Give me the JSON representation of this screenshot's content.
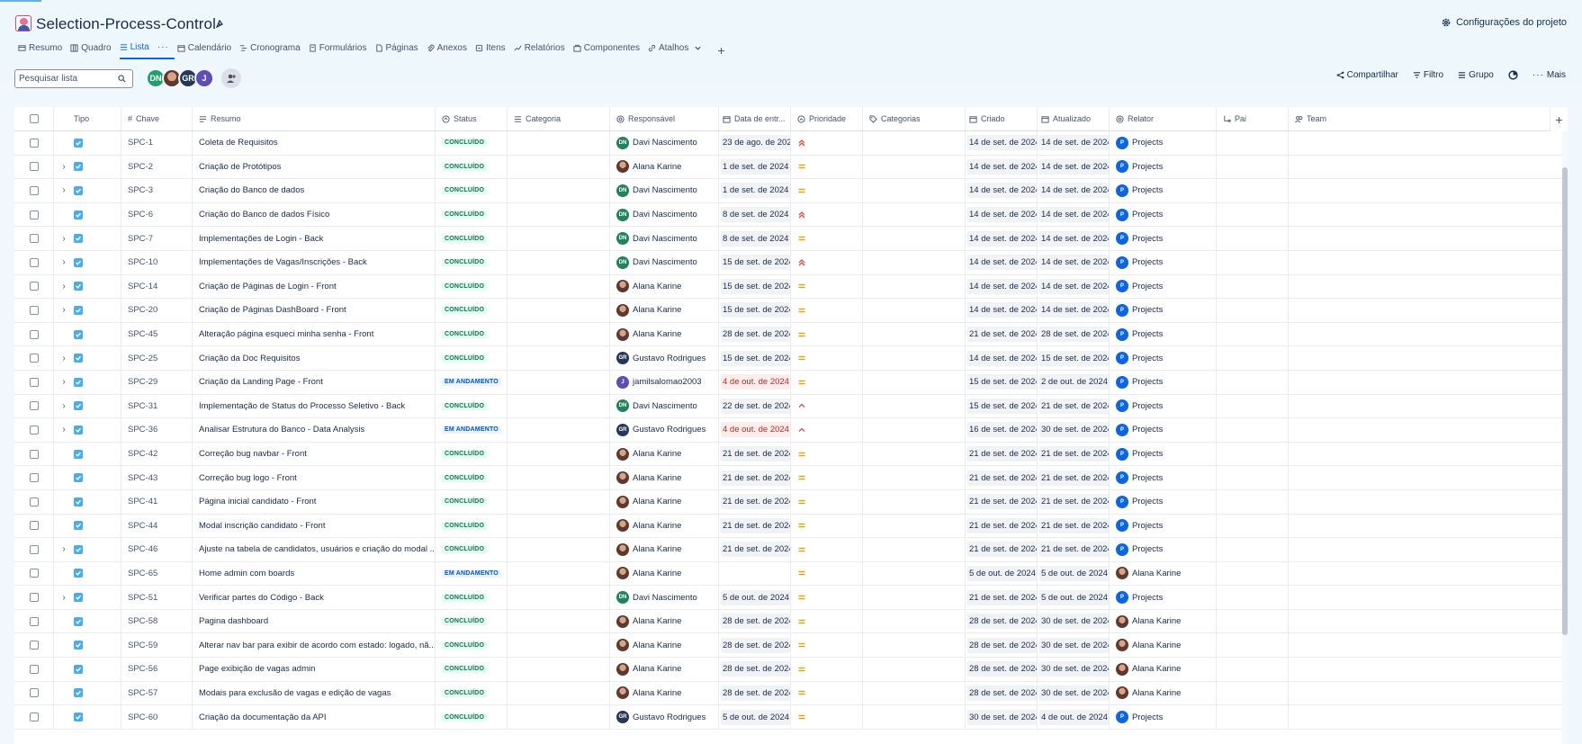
{
  "project": {
    "title": "Selection-Process-Control",
    "settings_label": "Configurações do projeto"
  },
  "tabs": [
    {
      "label": "Resumo",
      "icon": "summary-icon"
    },
    {
      "label": "Quadro",
      "icon": "board-icon"
    },
    {
      "label": "Lista",
      "icon": "list-icon",
      "active": true
    },
    {
      "label": "Calendário",
      "icon": "calendar-icon"
    },
    {
      "label": "Cronograma",
      "icon": "timeline-icon"
    },
    {
      "label": "Formulários",
      "icon": "form-icon"
    },
    {
      "label": "Páginas",
      "icon": "page-icon"
    },
    {
      "label": "Anexos",
      "icon": "attachment-icon"
    },
    {
      "label": "Itens",
      "icon": "issues-icon"
    },
    {
      "label": "Relatórios",
      "icon": "reports-icon"
    },
    {
      "label": "Componentes",
      "icon": "component-icon"
    },
    {
      "label": "Atalhos",
      "icon": "shortcut-icon"
    }
  ],
  "toolbar": {
    "search_placeholder": "Pesquisar lista",
    "avatars": [
      "DN",
      "",
      "GR",
      "J"
    ],
    "share_label": "Compartilhar",
    "filter_label": "Filtro",
    "group_label": "Grupo",
    "more_label": "Mais"
  },
  "columns": {
    "tipo": "Tipo",
    "chave": "Chave",
    "resumo": "Resumo",
    "status": "Status",
    "categoria": "Categoria",
    "responsavel": "Responsável",
    "data_entrega": "Data de entr...",
    "prioridade": "Prioridade",
    "categorias": "Categorias",
    "criado": "Criado",
    "atualizado": "Atualizado",
    "relator": "Relator",
    "pai": "Pai",
    "team": "Team"
  },
  "colors": {
    "done_bg": "#dcfff1",
    "done_fg": "#216e4e",
    "progress_bg": "#e9f2ff",
    "progress_fg": "#0055cc",
    "overdue": "#ae2e24",
    "accent": "#0c66e4"
  },
  "rows": [
    {
      "expand": false,
      "key": "SPC-1",
      "summary": "Coleta de Requisitos",
      "status": "CONCLUÍDO",
      "assignee": "Davi Nascimento",
      "assignee_initials": "DN",
      "due": "23 de ago. de 202",
      "due_overdue": false,
      "priority": "highest",
      "created": "14 de set. de 2024",
      "updated": "14 de set. de 2024",
      "reporter": "Projects",
      "reporter_initials": "P"
    },
    {
      "expand": true,
      "key": "SPC-2",
      "summary": "Criação de Protótipos",
      "status": "CONCLUÍDO",
      "assignee": "Alana Karine",
      "assignee_initials": "",
      "due": "1 de set. de 2024",
      "due_overdue": false,
      "priority": "medium",
      "created": "14 de set. de 2024",
      "updated": "14 de set. de 2024",
      "reporter": "Projects",
      "reporter_initials": "P"
    },
    {
      "expand": true,
      "key": "SPC-3",
      "summary": "Criação do Banco de dados",
      "status": "CONCLUÍDO",
      "assignee": "Davi Nascimento",
      "assignee_initials": "DN",
      "due": "1 de set. de 2024",
      "due_overdue": false,
      "priority": "medium",
      "created": "14 de set. de 2024",
      "updated": "14 de set. de 2024",
      "reporter": "Projects",
      "reporter_initials": "P"
    },
    {
      "expand": false,
      "key": "SPC-6",
      "summary": "Criação do Banco de dados Físico",
      "status": "CONCLUÍDO",
      "assignee": "Davi Nascimento",
      "assignee_initials": "DN",
      "due": "8 de set. de 2024",
      "due_overdue": false,
      "priority": "highest",
      "created": "14 de set. de 2024",
      "updated": "14 de set. de 2024",
      "reporter": "Projects",
      "reporter_initials": "P"
    },
    {
      "expand": true,
      "key": "SPC-7",
      "summary": "Implementações de Login - Back",
      "status": "CONCLUÍDO",
      "assignee": "Davi Nascimento",
      "assignee_initials": "DN",
      "due": "8 de set. de 2024",
      "due_overdue": false,
      "priority": "medium",
      "created": "14 de set. de 2024",
      "updated": "14 de set. de 2024",
      "reporter": "Projects",
      "reporter_initials": "P"
    },
    {
      "expand": true,
      "key": "SPC-10",
      "summary": "Implementações de Vagas/Inscrições - Back",
      "status": "CONCLUÍDO",
      "assignee": "Davi Nascimento",
      "assignee_initials": "DN",
      "due": "15 de set. de 2024",
      "due_overdue": false,
      "priority": "highest",
      "created": "14 de set. de 2024",
      "updated": "14 de set. de 2024",
      "reporter": "Projects",
      "reporter_initials": "P"
    },
    {
      "expand": true,
      "key": "SPC-14",
      "summary": "Criação de Páginas de Login - Front",
      "status": "CONCLUÍDO",
      "assignee": "Alana Karine",
      "assignee_initials": "",
      "due": "15 de set. de 2024",
      "due_overdue": false,
      "priority": "medium",
      "created": "14 de set. de 2024",
      "updated": "14 de set. de 2024",
      "reporter": "Projects",
      "reporter_initials": "P"
    },
    {
      "expand": true,
      "key": "SPC-20",
      "summary": "Criação de Páginas DashBoard - Front",
      "status": "CONCLUÍDO",
      "assignee": "Alana Karine",
      "assignee_initials": "",
      "due": "15 de set. de 2024",
      "due_overdue": false,
      "priority": "medium",
      "created": "14 de set. de 2024",
      "updated": "14 de set. de 2024",
      "reporter": "Projects",
      "reporter_initials": "P"
    },
    {
      "expand": false,
      "key": "SPC-45",
      "summary": "Alteração página esqueci minha senha - Front",
      "status": "CONCLUÍDO",
      "assignee": "Alana Karine",
      "assignee_initials": "",
      "due": "28 de set. de 2024",
      "due_overdue": false,
      "priority": "medium",
      "created": "21 de set. de 2024",
      "updated": "28 de set. de 2024",
      "reporter": "Projects",
      "reporter_initials": "P"
    },
    {
      "expand": true,
      "key": "SPC-25",
      "summary": "Criação da Doc Requisitos",
      "status": "CONCLUÍDO",
      "assignee": "Gustavo Rodrigues",
      "assignee_initials": "GR",
      "due": "15 de set. de 2024",
      "due_overdue": false,
      "priority": "medium",
      "created": "14 de set. de 2024",
      "updated": "15 de set. de 2024",
      "reporter": "Projects",
      "reporter_initials": "P"
    },
    {
      "expand": true,
      "key": "SPC-29",
      "summary": "Criação da Landing Page - Front",
      "status": "EM ANDAMENTO",
      "assignee": "jamilsalomao2003",
      "assignee_initials": "J",
      "due": "4 de out. de 2024",
      "due_overdue": true,
      "priority": "medium",
      "created": "15 de set. de 2024",
      "updated": "2 de out. de 2024",
      "reporter": "Projects",
      "reporter_initials": "P"
    },
    {
      "expand": true,
      "key": "SPC-31",
      "summary": "Implementação de Status do Processo Seletivo - Back",
      "status": "CONCLUÍDO",
      "assignee": "Davi Nascimento",
      "assignee_initials": "DN",
      "due": "22 de set. de 2024",
      "due_overdue": false,
      "priority": "high",
      "created": "15 de set. de 2024",
      "updated": "21 de set. de 2024",
      "reporter": "Projects",
      "reporter_initials": "P"
    },
    {
      "expand": true,
      "key": "SPC-36",
      "summary": "Analisar Estrutura do Banco - Data Analysis",
      "status": "EM ANDAMENTO",
      "assignee": "Gustavo Rodrigues",
      "assignee_initials": "GR",
      "due": "4 de out. de 2024",
      "due_overdue": true,
      "priority": "high",
      "created": "16 de set. de 2024",
      "updated": "30 de set. de 2024",
      "reporter": "Projects",
      "reporter_initials": "P"
    },
    {
      "expand": false,
      "key": "SPC-42",
      "summary": "Correção bug navbar - Front",
      "status": "CONCLUÍDO",
      "assignee": "Alana Karine",
      "assignee_initials": "",
      "due": "21 de set. de 2024",
      "due_overdue": false,
      "priority": "medium",
      "created": "21 de set. de 2024",
      "updated": "21 de set. de 2024",
      "reporter": "Projects",
      "reporter_initials": "P"
    },
    {
      "expand": false,
      "key": "SPC-43",
      "summary": "Correção bug logo - Front",
      "status": "CONCLUÍDO",
      "assignee": "Alana Karine",
      "assignee_initials": "",
      "due": "21 de set. de 2024",
      "due_overdue": false,
      "priority": "medium",
      "created": "21 de set. de 2024",
      "updated": "21 de set. de 2024",
      "reporter": "Projects",
      "reporter_initials": "P"
    },
    {
      "expand": false,
      "key": "SPC-41",
      "summary": "Página inicial candidato - Front",
      "status": "CONCLUÍDO",
      "assignee": "Alana Karine",
      "assignee_initials": "",
      "due": "21 de set. de 2024",
      "due_overdue": false,
      "priority": "medium",
      "created": "21 de set. de 2024",
      "updated": "21 de set. de 2024",
      "reporter": "Projects",
      "reporter_initials": "P"
    },
    {
      "expand": false,
      "key": "SPC-44",
      "summary": "Modal inscrição candidato - Front",
      "status": "CONCLUÍDO",
      "assignee": "Alana Karine",
      "assignee_initials": "",
      "due": "21 de set. de 2024",
      "due_overdue": false,
      "priority": "medium",
      "created": "21 de set. de 2024",
      "updated": "21 de set. de 2024",
      "reporter": "Projects",
      "reporter_initials": "P"
    },
    {
      "expand": true,
      "key": "SPC-46",
      "summary": "Ajuste na tabela de candidatos, usuários e criação do modal ...",
      "status": "CONCLUÍDO",
      "assignee": "Alana Karine",
      "assignee_initials": "",
      "due": "21 de set. de 2024",
      "due_overdue": false,
      "priority": "medium",
      "created": "21 de set. de 2024",
      "updated": "21 de set. de 2024",
      "reporter": "Projects",
      "reporter_initials": "P"
    },
    {
      "expand": false,
      "key": "SPC-65",
      "summary": "Home admin com boards",
      "status": "EM ANDAMENTO",
      "assignee": "Alana Karine",
      "assignee_initials": "",
      "due": "",
      "due_overdue": false,
      "priority": "medium",
      "created": "5 de out. de 2024",
      "updated": "5 de out. de 2024",
      "reporter": "Alana Karine",
      "reporter_initials": ""
    },
    {
      "expand": true,
      "key": "SPC-51",
      "summary": "Verificar partes do Código - Back",
      "status": "CONCLUÍDO",
      "assignee": "Davi Nascimento",
      "assignee_initials": "DN",
      "due": "5 de out. de 2024",
      "due_overdue": false,
      "priority": "medium",
      "created": "21 de set. de 2024",
      "updated": "5 de out. de 2024",
      "reporter": "Projects",
      "reporter_initials": "P"
    },
    {
      "expand": false,
      "key": "SPC-58",
      "summary": "Pagina dashboard",
      "status": "CONCLUÍDO",
      "assignee": "Alana Karine",
      "assignee_initials": "",
      "due": "28 de set. de 2024",
      "due_overdue": false,
      "priority": "medium",
      "created": "28 de set. de 2024",
      "updated": "30 de set. de 2024",
      "reporter": "Alana Karine",
      "reporter_initials": ""
    },
    {
      "expand": false,
      "key": "SPC-59",
      "summary": "Alterar nav bar para exibir de acordo com estado: logado, nã...",
      "status": "CONCLUÍDO",
      "assignee": "Alana Karine",
      "assignee_initials": "",
      "due": "28 de set. de 2024",
      "due_overdue": false,
      "priority": "medium",
      "created": "28 de set. de 2024",
      "updated": "30 de set. de 2024",
      "reporter": "Alana Karine",
      "reporter_initials": ""
    },
    {
      "expand": false,
      "key": "SPC-56",
      "summary": "Page exibição de vagas admin",
      "status": "CONCLUÍDO",
      "assignee": "Alana Karine",
      "assignee_initials": "",
      "due": "28 de set. de 2024",
      "due_overdue": false,
      "priority": "medium",
      "created": "28 de set. de 2024",
      "updated": "30 de set. de 2024",
      "reporter": "Alana Karine",
      "reporter_initials": ""
    },
    {
      "expand": false,
      "key": "SPC-57",
      "summary": "Modais para exclusão de vagas e edição de vagas",
      "status": "CONCLUÍDO",
      "assignee": "Alana Karine",
      "assignee_initials": "",
      "due": "28 de set. de 2024",
      "due_overdue": false,
      "priority": "medium",
      "created": "28 de set. de 2024",
      "updated": "30 de set. de 2024",
      "reporter": "Alana Karine",
      "reporter_initials": ""
    },
    {
      "expand": false,
      "key": "SPC-60",
      "summary": "Criação da documentação da API",
      "status": "CONCLUÍDO",
      "assignee": "Gustavo Rodrigues",
      "assignee_initials": "GR",
      "due": "5 de out. de 2024",
      "due_overdue": false,
      "priority": "medium",
      "created": "30 de set. de 2024",
      "updated": "4 de out. de 2024",
      "reporter": "Projects",
      "reporter_initials": "P"
    }
  ]
}
